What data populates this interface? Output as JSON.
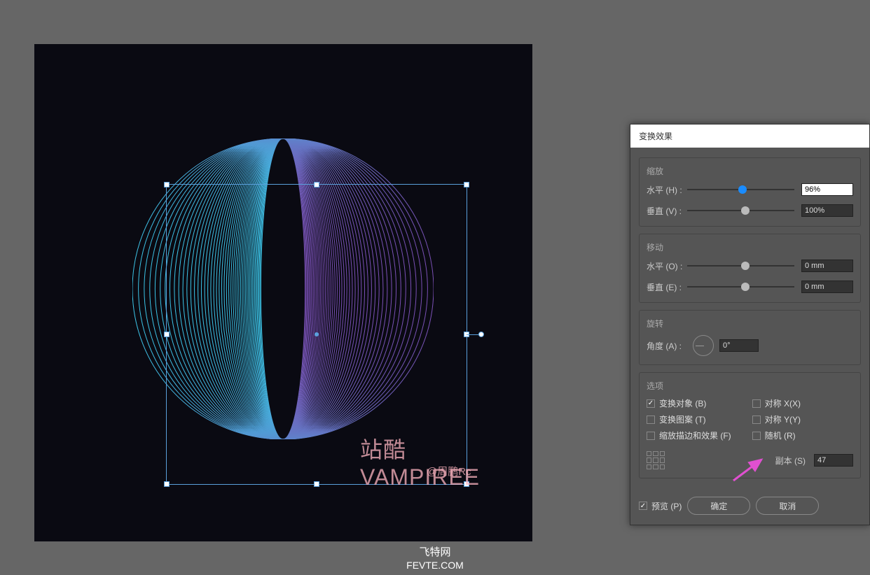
{
  "canvas": {
    "watermark": "站酷 VAMPIREE",
    "watermark_sub": "@周鹏Rc",
    "caption": "飞特网",
    "caption2": "FEVTE.COM"
  },
  "dialog": {
    "title": "变换效果",
    "scale": {
      "title": "缩放",
      "h_label": "水平 (H) :",
      "h_value": "96%",
      "v_label": "垂直 (V) :",
      "v_value": "100%"
    },
    "move": {
      "title": "移动",
      "h_label": "水平 (O) :",
      "h_value": "0 mm",
      "v_label": "垂直 (E) :",
      "v_value": "0 mm"
    },
    "rotate": {
      "title": "旋转",
      "a_label": "角度 (A) :",
      "a_value": "0°"
    },
    "options": {
      "title": "选项",
      "transform_obj": "变换对象 (B)",
      "transform_pat": "变换图案 (T)",
      "scale_stroke": "缩放描边和效果 (F)",
      "mirror_x": "对称 X(X)",
      "mirror_y": "对称 Y(Y)",
      "random": "随机 (R)",
      "copies_label": "副本 (S)",
      "copies_value": "47"
    },
    "preview": "预览 (P)",
    "ok": "确定",
    "cancel": "取消"
  }
}
